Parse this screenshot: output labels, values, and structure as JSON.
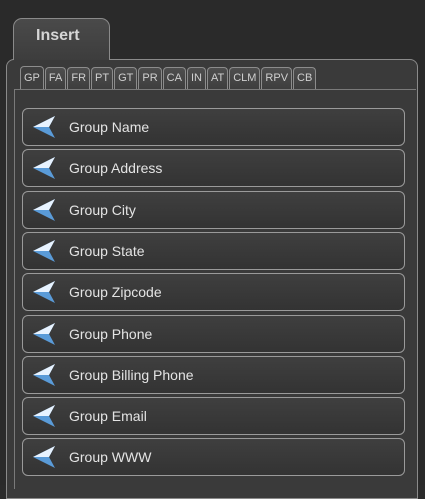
{
  "outer_tab": {
    "label": "Insert"
  },
  "inner_tabs": [
    {
      "label": "GP",
      "active": true
    },
    {
      "label": "FA"
    },
    {
      "label": "FR"
    },
    {
      "label": "PT"
    },
    {
      "label": "GT"
    },
    {
      "label": "PR"
    },
    {
      "label": "CA"
    },
    {
      "label": "IN"
    },
    {
      "label": "AT"
    },
    {
      "label": "CLM"
    },
    {
      "label": "RPV"
    },
    {
      "label": "CB"
    }
  ],
  "items": [
    {
      "label": "Group Name",
      "icon": "arrow-left-icon"
    },
    {
      "label": "Group Address",
      "icon": "arrow-left-icon"
    },
    {
      "label": "Group City",
      "icon": "arrow-left-icon"
    },
    {
      "label": "Group State",
      "icon": "arrow-left-icon"
    },
    {
      "label": "Group Zipcode",
      "icon": "arrow-left-icon"
    },
    {
      "label": "Group Phone",
      "icon": "arrow-left-icon"
    },
    {
      "label": "Group Billing Phone",
      "icon": "arrow-left-icon"
    },
    {
      "label": "Group Email",
      "icon": "arrow-left-icon"
    },
    {
      "label": "Group WWW",
      "icon": "arrow-left-icon"
    }
  ],
  "colors": {
    "background": "#2a2a2a",
    "panel": "#3a3a3a",
    "border": "#8a8a8a",
    "icon_light": "#e8f3ff",
    "icon_dark": "#5a9bd8"
  }
}
